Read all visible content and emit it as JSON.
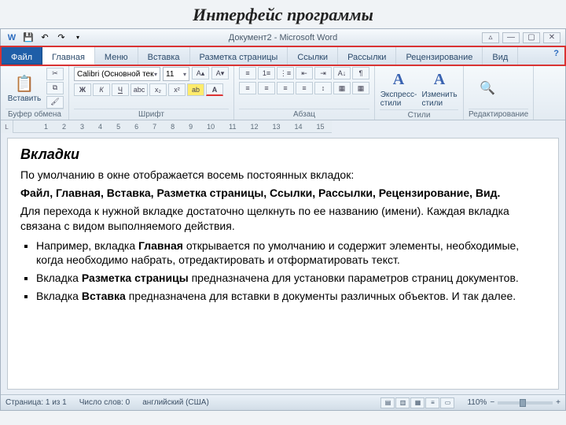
{
  "slide_title": "Интерфейс программы",
  "title_bar": "Документ2 - Microsoft Word",
  "tabs": {
    "file": "Файл",
    "home": "Главная",
    "menu": "Меню",
    "insert": "Вставка",
    "layout": "Разметка страницы",
    "links": "Ссылки",
    "mailings": "Рассылки",
    "review": "Рецензирование",
    "view": "Вид"
  },
  "groups": {
    "clipboard": {
      "label": "Буфер обмена",
      "paste": "Вставить"
    },
    "font": {
      "label": "Шрифт",
      "name": "Calibri (Основной тек",
      "size": "11"
    },
    "para": {
      "label": "Абзац"
    },
    "styles": {
      "label": "Стили",
      "quick": "Экспресс-стили",
      "change": "Изменить стили"
    },
    "editing": {
      "label": "Редактирование"
    }
  },
  "ruler_marks": [
    "1",
    "2",
    "3",
    "4",
    "5",
    "6",
    "7",
    "8",
    "9",
    "10",
    "11",
    "12",
    "13",
    "14",
    "15"
  ],
  "doc": {
    "heading": "Вкладки",
    "p1": "По умолчанию в окне отображается восемь постоянных вкладок:",
    "p2_pre": "Файл,   Главная,  Вставка,   Разметка страницы,   Ссылки,  Рассылки,  Рецензирование,   Вид.",
    "p3": "Для перехода к нужной вкладке достаточно щелкнуть по ее названию (имени). Каждая вкладка связана с видом выполняемого действия.",
    "b1a": "Например, вкладка ",
    "b1b": "Главная",
    "b1c": " открывается по умолчанию  и содержит элементы, необходимые, когда необходимо набрать, отредактировать и отформатировать текст.",
    "b2a": "Вкладка ",
    "b2b": "Разметка страницы",
    "b2c": " предназначена для установки параметров страниц документов.",
    "b3a": " Вкладка ",
    "b3b": "Вставка",
    "b3c": " предназначена для вставки в документы различных объектов. И так далее."
  },
  "status": {
    "page": "Страница: 1 из 1",
    "words": "Число слов: 0",
    "lang": "английский (США)",
    "zoom": "110%"
  }
}
